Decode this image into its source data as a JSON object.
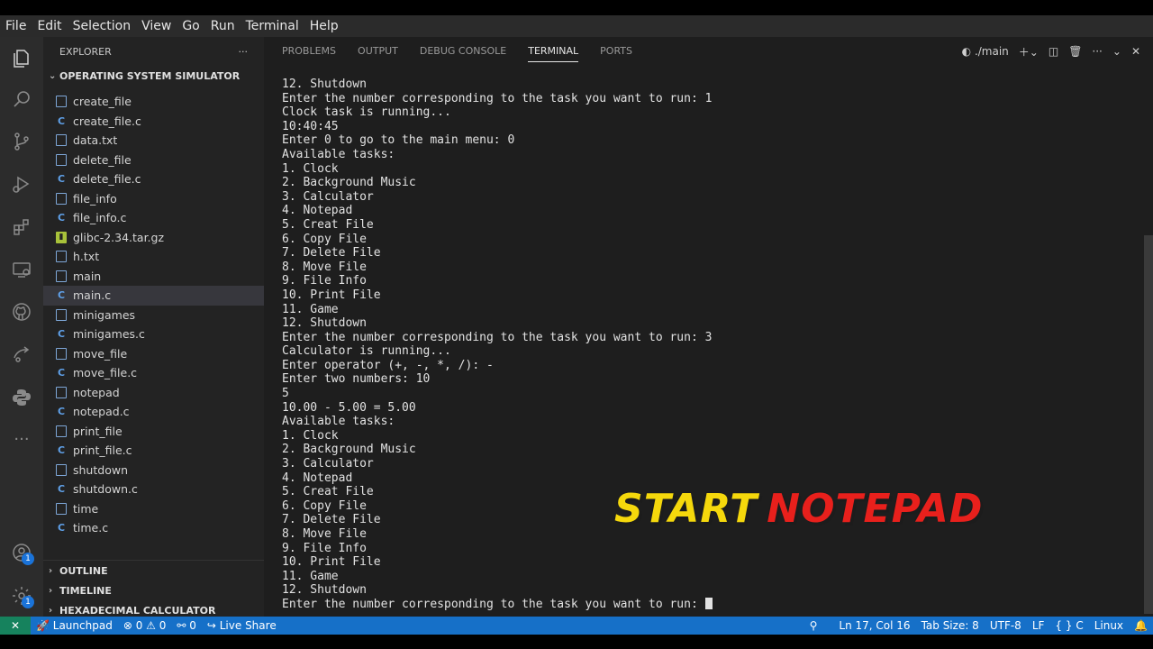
{
  "menu": [
    "File",
    "Edit",
    "Selection",
    "View",
    "Go",
    "Run",
    "Terminal",
    "Help"
  ],
  "explorer": {
    "title": "EXPLORER",
    "more": "···",
    "project": "OPERATING SYSTEM SIMULATOR",
    "files": [
      {
        "name": "create_file",
        "type": "doc"
      },
      {
        "name": "create_file.c",
        "type": "c"
      },
      {
        "name": "data.txt",
        "type": "doc"
      },
      {
        "name": "delete_file",
        "type": "doc"
      },
      {
        "name": "delete_file.c",
        "type": "c"
      },
      {
        "name": "file_info",
        "type": "doc"
      },
      {
        "name": "file_info.c",
        "type": "c"
      },
      {
        "name": "glibc-2.34.tar.gz",
        "type": "gz"
      },
      {
        "name": "h.txt",
        "type": "doc"
      },
      {
        "name": "main",
        "type": "doc"
      },
      {
        "name": "main.c",
        "type": "c",
        "selected": true
      },
      {
        "name": "minigames",
        "type": "doc"
      },
      {
        "name": "minigames.c",
        "type": "c"
      },
      {
        "name": "move_file",
        "type": "doc"
      },
      {
        "name": "move_file.c",
        "type": "c"
      },
      {
        "name": "notepad",
        "type": "doc"
      },
      {
        "name": "notepad.c",
        "type": "c"
      },
      {
        "name": "print_file",
        "type": "doc"
      },
      {
        "name": "print_file.c",
        "type": "c"
      },
      {
        "name": "shutdown",
        "type": "doc"
      },
      {
        "name": "shutdown.c",
        "type": "c"
      },
      {
        "name": "time",
        "type": "doc"
      },
      {
        "name": "time.c",
        "type": "c"
      }
    ],
    "sections": [
      "OUTLINE",
      "TIMELINE",
      "HEXADECIMAL CALCULATOR"
    ]
  },
  "panel": {
    "tabs": [
      "PROBLEMS",
      "OUTPUT",
      "DEBUG CONSOLE",
      "TERMINAL",
      "PORTS"
    ],
    "active_tab": "TERMINAL",
    "terminal_name": "./main"
  },
  "terminal_lines": [
    "12. Shutdown",
    "Enter the number corresponding to the task you want to run: 1",
    "Clock task is running...",
    "10:40:45",
    "Enter 0 to go to the main menu: 0",
    "Available tasks:",
    "1. Clock",
    "2. Background Music",
    "3. Calculator",
    "4. Notepad",
    "5. Creat File",
    "6. Copy File",
    "7. Delete File",
    "8. Move File",
    "9. File Info",
    "10. Print File",
    "11. Game",
    "12. Shutdown",
    "Enter the number corresponding to the task you want to run: 3",
    "Calculator is running...",
    "Enter operator (+, -, *, /): -",
    "Enter two numbers: 10",
    "5",
    "10.00 - 5.00 = 5.00",
    "Available tasks:",
    "1. Clock",
    "2. Background Music",
    "3. Calculator",
    "4. Notepad",
    "5. Creat File",
    "6. Copy File",
    "7. Delete File",
    "8. Move File",
    "9. File Info",
    "10. Print File",
    "11. Game",
    "12. Shutdown",
    "Enter the number corresponding to the task you want to run:"
  ],
  "overlay": {
    "word1": "START",
    "word2": "NOTEPAD"
  },
  "status": {
    "remote": "✕",
    "launchpad": "Launchpad",
    "errors": "0",
    "warnings": "0",
    "ports": "0",
    "live_share": "Live Share",
    "position": "Ln 17, Col 16",
    "tab_size": "Tab Size: 8",
    "encoding": "UTF-8",
    "eol": "LF",
    "language": "C",
    "os": "Linux"
  },
  "badges": {
    "accounts": "1",
    "settings": "1"
  }
}
